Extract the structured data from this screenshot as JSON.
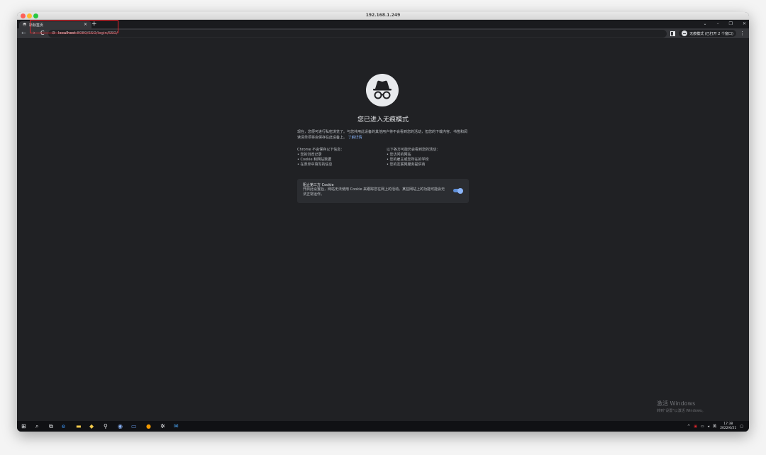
{
  "window": {
    "title": "192.168.1.249"
  },
  "tab": {
    "title": "新标签页",
    "close": "×",
    "new_tab": "+"
  },
  "window_controls": {
    "chevron": "⌄",
    "minimize": "–",
    "restore": "❐",
    "close": "✕"
  },
  "toolbar": {
    "back": "←",
    "forward": "→",
    "reload": "C",
    "url_host": "localhost",
    "url_rest": ":8080/SSO/login/SSO/",
    "incognito_label": "无痕模式 (已打开 2 个窗口)",
    "menu": "⋮"
  },
  "page": {
    "title": "您已进入无痕模式",
    "intro": "现在，您便可进行私密浏览了。与您共用此设备的其他用户将不会看到您的活动，但您的下载内容、书签和阅读清单项将会保存在此设备上。",
    "learn_more": "了解详情",
    "not_saved_heading": "Chrome 不会保存以下信息：",
    "not_saved": [
      "您的浏览记录",
      "Cookie 和网站数据",
      "在表单中填写的信息"
    ],
    "visible_heading": "以下各方可能仍会看到您的活动：",
    "visible": [
      "您访问的网站",
      "您的雇主或您所在的学校",
      "您的互联网服务提供商"
    ],
    "cookie_title": "阻止第三方 Cookie",
    "cookie_desc": "开启此设置后，网站无法使用 Cookie 来跟踪您在网上的活动。某些网站上的功能可能会无法正常运作。",
    "cookie_toggle_on": true
  },
  "watermark": {
    "line1": "激活 Windows",
    "line2": "转到\"设置\"以激活 Windows。"
  },
  "taskbar": {
    "icons": [
      "windows-start",
      "search",
      "task-view",
      "edge",
      "file-explorer",
      "app",
      "app",
      "app",
      "app",
      "chrome",
      "settings",
      "mail"
    ],
    "tray": {
      "ime": "英",
      "time": "17:38",
      "date": "2022/6/21"
    }
  }
}
